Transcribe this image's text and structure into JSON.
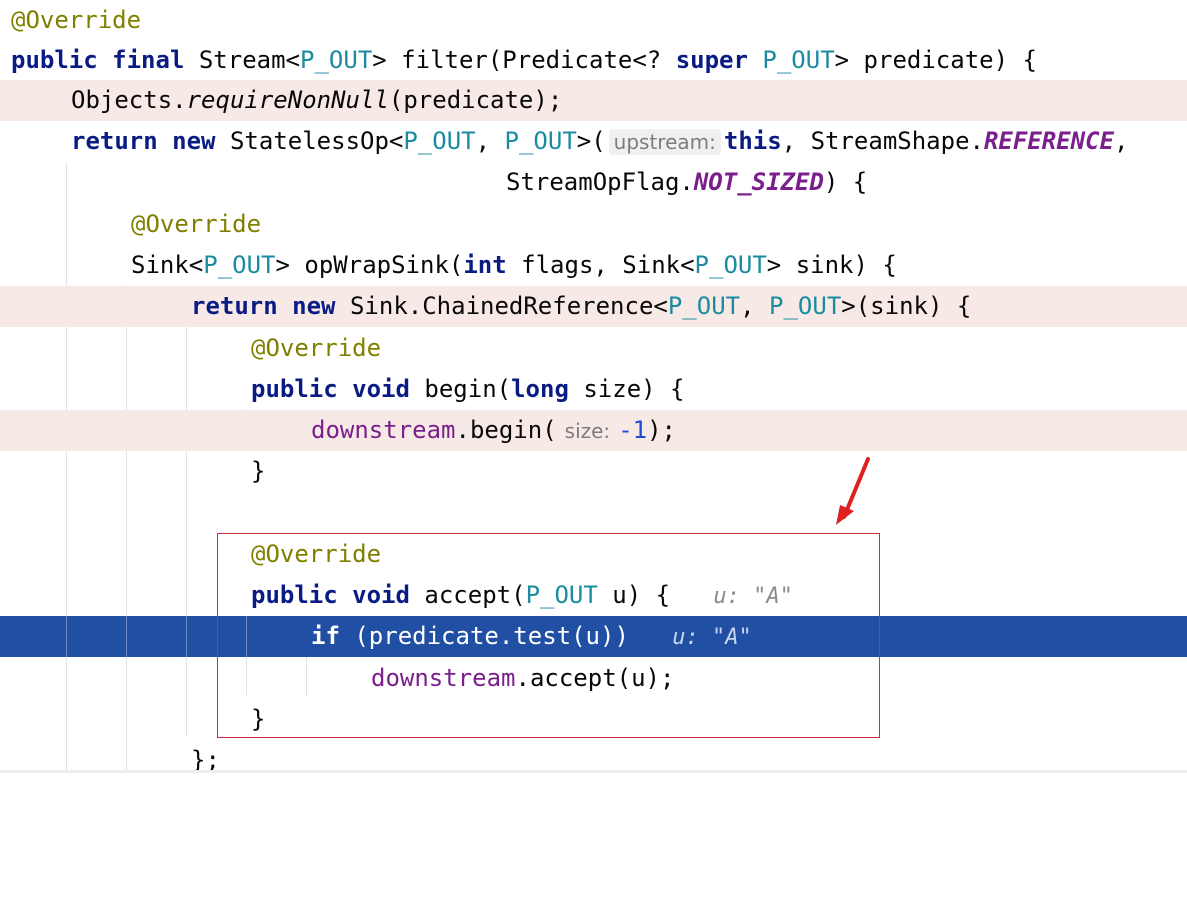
{
  "editor": {
    "lines": [
      {
        "ann": "@Override"
      },
      {
        "kw1": "public",
        "kw2": "final",
        "t1": "Stream<",
        "tp1": "P_OUT",
        "t2": "> filter(Predicate<? ",
        "kw3": "super",
        "tp2": "P_OUT",
        "t3": "> predicate) {"
      },
      {
        "t1": "Objects.",
        "m1": "requireNonNull",
        "t2": "(predicate);"
      },
      {
        "kw1": "return",
        "kw2": "new",
        "t1": "StatelessOp<",
        "tp1": "P_OUT",
        "t2": ", ",
        "tp2": "P_OUT",
        "t3": ">(",
        "hint": "upstream:",
        "kw3": "this",
        "t4": ", StreamShape.",
        "c1": "REFERENCE",
        "t5": ","
      },
      {
        "t1": "StreamOpFlag.",
        "c1": "NOT_SIZED",
        "t2": ") {"
      },
      {
        "ann": "@Override"
      },
      {
        "t1": "Sink<",
        "tp1": "P_OUT",
        "t2": "> opWrapSink(",
        "kw1": "int",
        "t3": " flags, Sink<",
        "tp2": "P_OUT",
        "t4": "> sink) {"
      },
      {
        "kw1": "return",
        "kw2": "new",
        "t1": "Sink.ChainedReference<",
        "tp1": "P_OUT",
        "t2": ", ",
        "tp2": "P_OUT",
        "t3": ">(sink) {"
      },
      {
        "ann": "@Override"
      },
      {
        "kw1": "public",
        "kw2": "void",
        "t1": "begin(",
        "kw3": "long",
        "t2": " size) {"
      },
      {
        "f1": "downstream",
        "t1": ".begin(",
        "hint": "size:",
        "n1": "-1",
        "t2": ");"
      },
      {
        "t1": "}"
      },
      {
        "t1": ""
      },
      {
        "ann": "@Override"
      },
      {
        "kw1": "public",
        "kw2": "void",
        "t1": "accept(",
        "tp1": "P_OUT",
        "t2": " u) {",
        "val": "u: \"A\""
      },
      {
        "kw1": "if",
        "t1": " (predicate.test(u))",
        "val": "u: \"A\""
      },
      {
        "f1": "downstream",
        "t1": ".accept(u);"
      },
      {
        "t1": "}"
      },
      {
        "t1": "};"
      }
    ]
  },
  "colors": {
    "annotation": "#808000",
    "keyword": "#0a1c84",
    "type_param": "#1b8ca0",
    "field": "#7a1f8c",
    "highlight_line": "#f7e9e6",
    "execution_line": "#214fa3",
    "focus_box": "#c8323a",
    "arrow": "#e02020"
  }
}
